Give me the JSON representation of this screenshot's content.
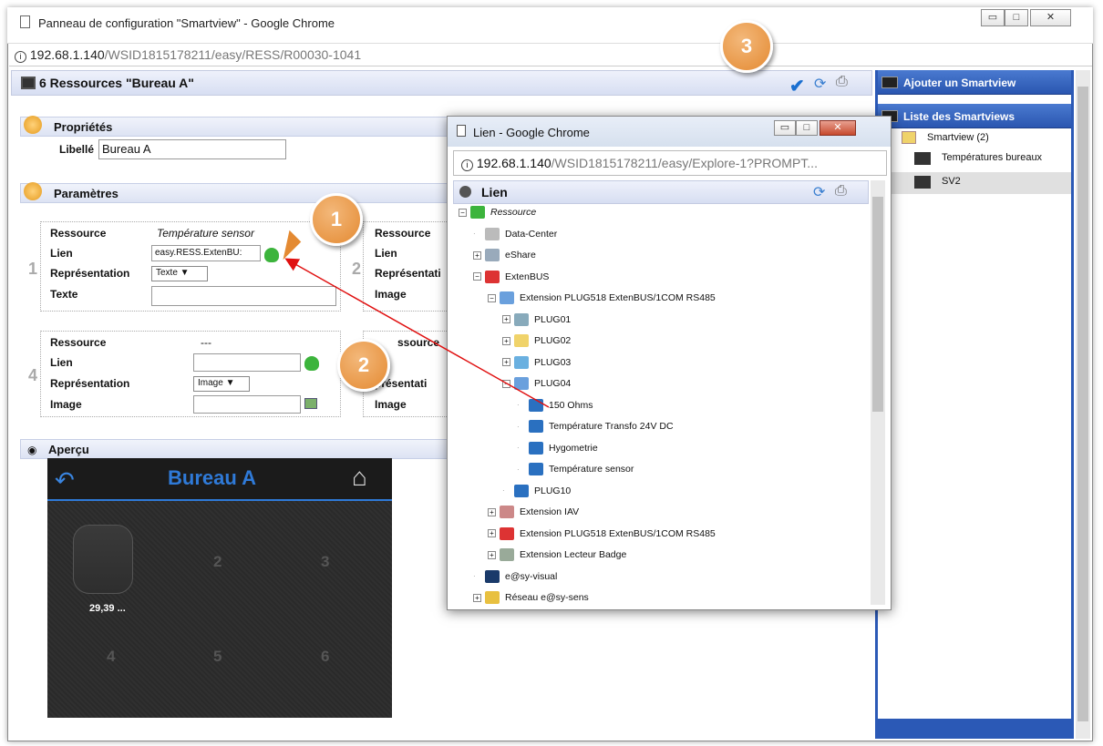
{
  "window": {
    "title": "Panneau de configuration \"Smartview\" - Google Chrome",
    "url_host": "192.68.1.140",
    "url_path": "/WSID1815178211/easy/RESS/R00030-1041"
  },
  "header": {
    "title": "6 Ressources \"Bureau A\""
  },
  "properties": {
    "section": "Propriétés",
    "libelle_label": "Libellé",
    "libelle_value": "Bureau A"
  },
  "parameters": {
    "section": "Paramètres",
    "block1": {
      "num": "1",
      "ressource_label": "Ressource",
      "ressource_value": "Température sensor",
      "lien_label": "Lien",
      "lien_value": "easy.RESS.ExtenBU:",
      "repr_label": "Représentation",
      "repr_value": "Texte ▼",
      "texte_label": "Texte"
    },
    "block2": {
      "num": "2",
      "ressource_label": "Ressource",
      "lien_label": "Lien",
      "repr_label": "Représentati",
      "image_label": "Image"
    },
    "block4": {
      "num": "4",
      "ressource_label": "Ressource",
      "ressource_value": "---",
      "lien_label": "Lien",
      "repr_label": "Représentation",
      "repr_value": "Image ▼",
      "image_label": "Image"
    },
    "block5": {
      "ressource_label": "ssource",
      "repr_label": "présentati",
      "image_label": "Image"
    }
  },
  "preview": {
    "section": "Aperçu",
    "title": "Bureau A",
    "cells": [
      "2",
      "3",
      "4",
      "5",
      "6"
    ],
    "value": "29,39 ..."
  },
  "callouts": [
    "1",
    "2",
    "3"
  ],
  "sidebar": {
    "add": "Ajouter un Smartview",
    "list": "Liste des Smartviews",
    "root": "Smartview (2)",
    "items": [
      "Températures bureaux",
      "SV2"
    ]
  },
  "popup": {
    "title": "Lien - Google Chrome",
    "url_host": "192.68.1.140",
    "url_path": "/WSID1815178211/easy/Explore-1?PROMPT...",
    "header": "Lien",
    "tree": [
      {
        "label": "Ressource",
        "expander": "⊟"
      },
      {
        "label": "Data-Center",
        "expander": "·"
      },
      {
        "label": "eShare",
        "expander": "⊞"
      },
      {
        "label": "ExtenBUS",
        "expander": "⊟"
      },
      {
        "label": "Extension PLUG518 ExtenBUS/1COM RS485",
        "expander": "⊟"
      },
      {
        "label": "PLUG01",
        "expander": "⊞"
      },
      {
        "label": "PLUG02",
        "expander": "⊞"
      },
      {
        "label": "PLUG03",
        "expander": "⊞"
      },
      {
        "label": "PLUG04",
        "expander": "⊟"
      },
      {
        "label": "150 Ohms",
        "expander": "·"
      },
      {
        "label": "Température Transfo 24V DC",
        "expander": "·"
      },
      {
        "label": "Hygometrie",
        "expander": "·"
      },
      {
        "label": "Température sensor",
        "expander": "·"
      },
      {
        "label": "PLUG10",
        "expander": "·"
      },
      {
        "label": "Extension IAV",
        "expander": "⊞"
      },
      {
        "label": "Extension PLUG518 ExtenBUS/1COM RS485",
        "expander": "⊞"
      },
      {
        "label": "Extension Lecteur Badge",
        "expander": "⊞"
      },
      {
        "label": "e@sy-visual",
        "expander": "·"
      },
      {
        "label": "Réseau e@sy-sens",
        "expander": "⊞"
      }
    ]
  },
  "colors": {
    "accent": "#2b59b6",
    "callout": "#e48a32",
    "preview_title": "#2f7ad8"
  }
}
